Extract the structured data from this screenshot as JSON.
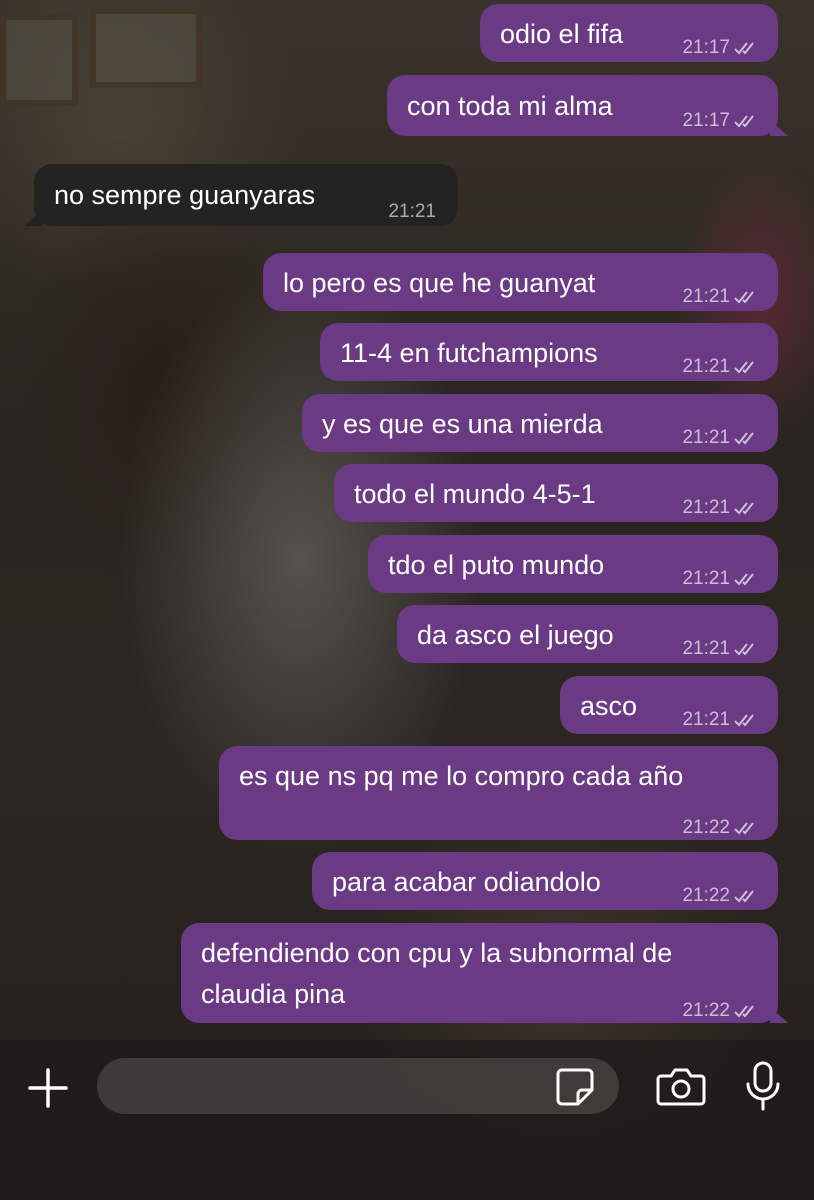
{
  "colors": {
    "outgoing_bubble": "#6a3a84",
    "incoming_bubble": "#232323",
    "text": "#ffffff"
  },
  "messages": [
    {
      "dir": "out",
      "lines": [
        "odio el fifa"
      ],
      "time": "21:17",
      "status": "read"
    },
    {
      "dir": "out",
      "lines": [
        "con toda mi alma"
      ],
      "time": "21:17",
      "status": "read"
    },
    {
      "dir": "in",
      "lines": [
        "no sempre guanyaras"
      ],
      "time": "21:21"
    },
    {
      "dir": "out",
      "lines": [
        "lo pero es que he guanyat"
      ],
      "time": "21:21",
      "status": "read"
    },
    {
      "dir": "out",
      "lines": [
        "11-4 en futchampions"
      ],
      "time": "21:21",
      "status": "read"
    },
    {
      "dir": "out",
      "lines": [
        "y es que es una mierda"
      ],
      "time": "21:21",
      "status": "read"
    },
    {
      "dir": "out",
      "lines": [
        "todo el mundo 4-5-1"
      ],
      "time": "21:21",
      "status": "read"
    },
    {
      "dir": "out",
      "lines": [
        "tdo el puto mundo"
      ],
      "time": "21:21",
      "status": "read"
    },
    {
      "dir": "out",
      "lines": [
        "da asco el juego"
      ],
      "time": "21:21",
      "status": "read"
    },
    {
      "dir": "out",
      "lines": [
        "asco"
      ],
      "time": "21:21",
      "status": "read"
    },
    {
      "dir": "out",
      "lines": [
        "es que ns pq me lo compro cada año"
      ],
      "time": "21:22",
      "status": "read"
    },
    {
      "dir": "out",
      "lines": [
        "para acabar odiandolo"
      ],
      "time": "21:22",
      "status": "read"
    },
    {
      "dir": "out",
      "lines": [
        "defendiendo con cpu y la subnormal de",
        "claudia pina"
      ],
      "time": "21:22",
      "status": "read"
    }
  ],
  "input_bar": {
    "placeholder": "",
    "value": "",
    "icons": [
      "plus-icon",
      "sticker-icon",
      "camera-icon",
      "microphone-icon"
    ]
  }
}
